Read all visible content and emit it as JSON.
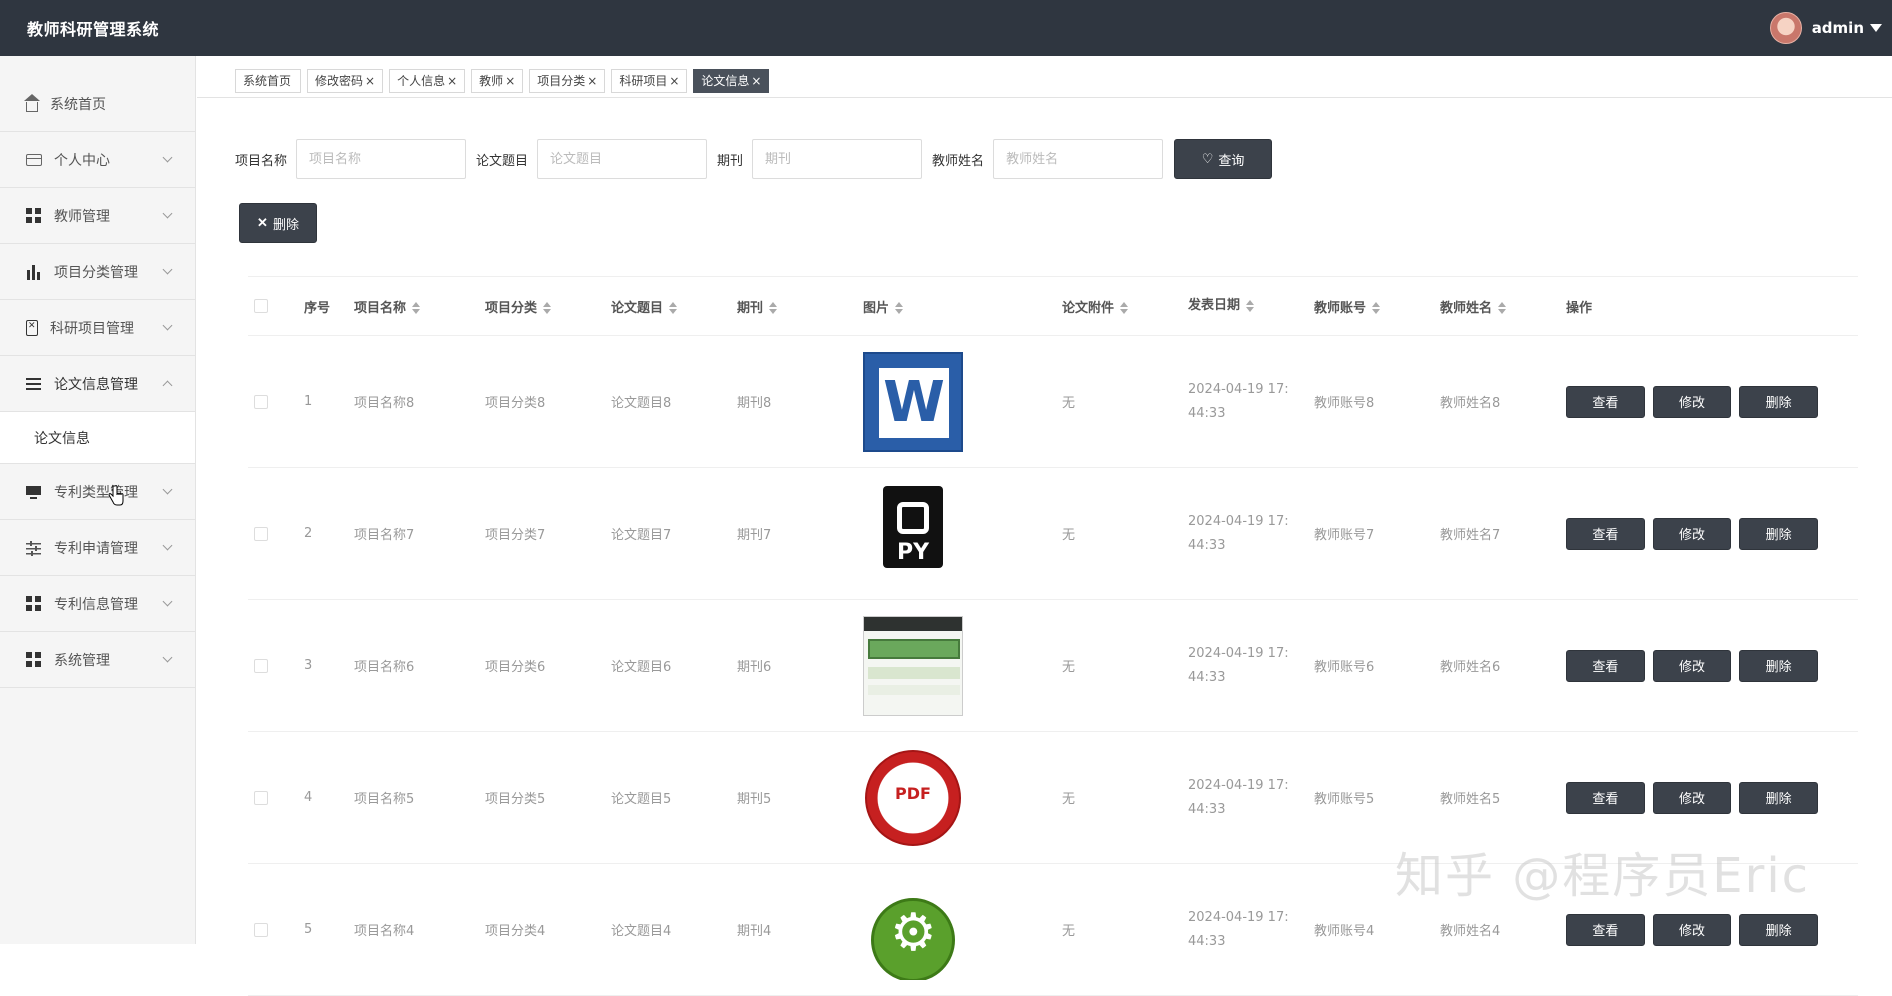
{
  "app": {
    "title": "教师科研管理系统",
    "user": "admin"
  },
  "sidebar": {
    "items": [
      {
        "label": "系统首页",
        "icon": "home-icon"
      },
      {
        "label": "个人中心",
        "icon": "card-icon"
      },
      {
        "label": "教师管理",
        "icon": "grid-icon"
      },
      {
        "label": "项目分类管理",
        "icon": "bar-chart-icon"
      },
      {
        "label": "科研项目管理",
        "icon": "clipboard-icon"
      },
      {
        "label": "论文信息管理",
        "icon": "list-icon"
      },
      {
        "label": "专利类型管理",
        "icon": "monitor-icon"
      },
      {
        "label": "专利申请管理",
        "icon": "sliders-icon"
      },
      {
        "label": "专利信息管理",
        "icon": "grid-icon"
      },
      {
        "label": "系统管理",
        "icon": "grid-icon"
      }
    ],
    "submenu": {
      "label": "论文信息"
    }
  },
  "tabs": [
    {
      "label": "系统首页",
      "close": ""
    },
    {
      "label": "修改密码",
      "close": "×"
    },
    {
      "label": "个人信息",
      "close": "×"
    },
    {
      "label": "教师",
      "close": "×"
    },
    {
      "label": "项目分类",
      "close": "×"
    },
    {
      "label": "科研项目",
      "close": "×"
    },
    {
      "label": "论文信息",
      "close": "×"
    }
  ],
  "search": {
    "project_label": "项目名称",
    "project_placeholder": "项目名称",
    "topic_label": "论文题目",
    "topic_placeholder": "论文题目",
    "journal_label": "期刊",
    "journal_placeholder": "期刊",
    "teacher_label": "教师姓名",
    "teacher_placeholder": "教师姓名",
    "query_label": "查询",
    "delete_label": "删除"
  },
  "table": {
    "headers": {
      "no": "序号",
      "name": "项目名称",
      "cat": "项目分类",
      "topic": "论文题目",
      "journal": "期刊",
      "img": "图片",
      "att": "论文附件",
      "date": "发表日期",
      "acc": "教师账号",
      "tname": "教师姓名",
      "ops": "操作"
    },
    "rows": [
      {
        "no": "1",
        "name": "项目名称8",
        "cat": "项目分类8",
        "topic": "论文题目8",
        "journal": "期刊8",
        "img": "word-icon",
        "att": "无",
        "date1": "2024-04-19 17:",
        "date2": "44:33",
        "acc": "教师账号8",
        "tname": "教师姓名8"
      },
      {
        "no": "2",
        "name": "项目名称7",
        "cat": "项目分类7",
        "topic": "论文题目7",
        "journal": "期刊7",
        "img": "python-file-icon",
        "att": "无",
        "date1": "2024-04-19 17:",
        "date2": "44:33",
        "acc": "教师账号7",
        "tname": "教师姓名7"
      },
      {
        "no": "3",
        "name": "项目名称6",
        "cat": "项目分类6",
        "topic": "论文题目6",
        "journal": "期刊6",
        "img": "screenshot-thumbnail",
        "att": "无",
        "date1": "2024-04-19 17:",
        "date2": "44:33",
        "acc": "教师账号6",
        "tname": "教师姓名6"
      },
      {
        "no": "4",
        "name": "项目名称5",
        "cat": "项目分类5",
        "topic": "论文题目5",
        "journal": "期刊5",
        "img": "pdf-icon",
        "att": "无",
        "date1": "2024-04-19 17:",
        "date2": "44:33",
        "acc": "教师账号5",
        "tname": "教师姓名5"
      },
      {
        "no": "5",
        "name": "项目名称4",
        "cat": "项目分类4",
        "topic": "论文题目4",
        "journal": "期刊4",
        "img": "gear-icon",
        "att": "无",
        "date1": "2024-04-19 17:",
        "date2": "44:33",
        "acc": "教师账号4",
        "tname": "教师姓名4"
      }
    ],
    "ops": {
      "view": "查看",
      "edit": "修改",
      "delete": "删除"
    }
  },
  "watermark": "知乎 @程序员Eric",
  "colors": {
    "topbar": "#2f3640",
    "button": "#3c424b",
    "active_tab": "#4a515b"
  }
}
